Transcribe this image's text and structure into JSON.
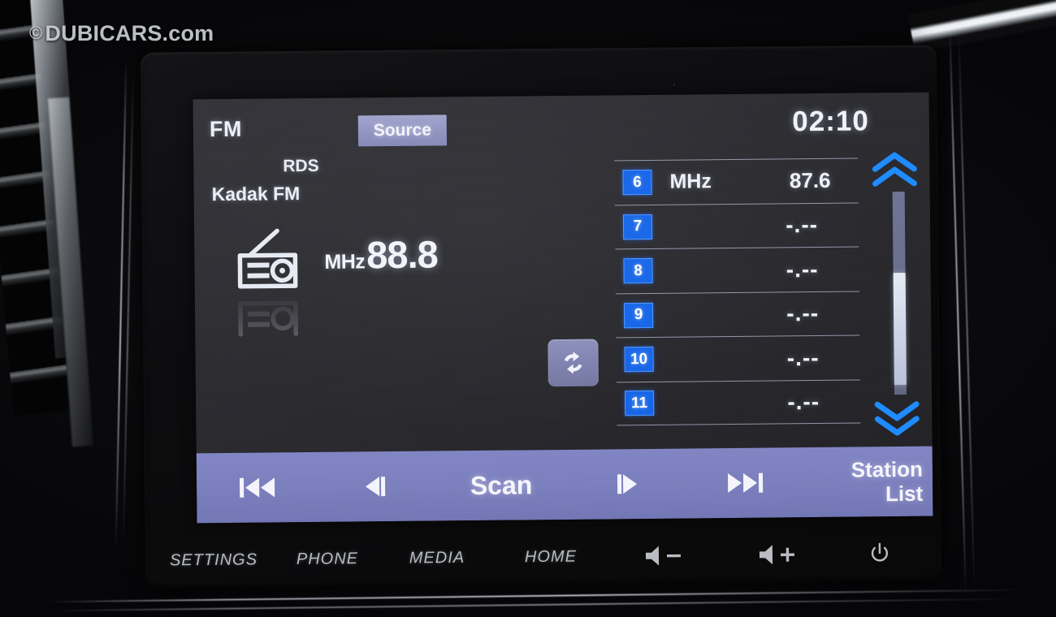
{
  "watermark": {
    "symbol": "©",
    "text": "DUBICARS.com"
  },
  "screen": {
    "status": {
      "band": "FM",
      "source_label": "Source",
      "clock": "02:10"
    },
    "now_playing": {
      "rds_label": "RDS",
      "station_name": "Kadak FM",
      "frequency_unit": "MHz",
      "frequency_value": "88.8",
      "radio_icon": "radio-icon",
      "refresh_icon": "refresh-icon"
    },
    "presets": {
      "rows": [
        {
          "number": "6",
          "unit": "MHz",
          "value": "87.6",
          "empty": false
        },
        {
          "number": "7",
          "unit": "",
          "value": "-.--",
          "empty": true
        },
        {
          "number": "8",
          "unit": "",
          "value": "-.--",
          "empty": true
        },
        {
          "number": "9",
          "unit": "",
          "value": "-.--",
          "empty": true
        },
        {
          "number": "10",
          "unit": "",
          "value": "-.--",
          "empty": true
        },
        {
          "number": "11",
          "unit": "",
          "value": "-.--",
          "empty": true
        }
      ],
      "scroll_up_icon": "chevron-double-up-icon",
      "scroll_down_icon": "chevron-double-down-icon"
    },
    "controls": {
      "previous_icon": "skip-previous-icon",
      "tune_down_icon": "tune-down-icon",
      "scan_label": "Scan",
      "tune_up_icon": "tune-up-icon",
      "next_icon": "skip-next-icon",
      "station_list_line1": "Station",
      "station_list_line2": "List"
    }
  },
  "hardware_buttons": {
    "settings": "SETTINGS",
    "phone": "PHONE",
    "media": "MEDIA",
    "home": "HOME",
    "volume_down_icon": "volume-down-icon",
    "volume_up_icon": "volume-up-icon",
    "power_icon": "power-icon"
  },
  "colors": {
    "accent_purple": "#7b7fbd",
    "preset_blue": "#1565e8",
    "chevron_blue": "#1e8bff",
    "lcd_background": "#2c2c31",
    "text_light": "#f0f2f8"
  }
}
